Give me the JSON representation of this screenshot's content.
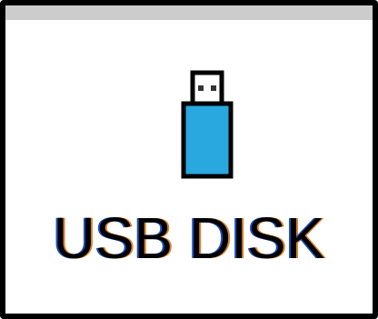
{
  "tile": {
    "label": "USB DISK"
  },
  "icon": {
    "name": "usb-drive-icon",
    "body_color": "#29a8e0",
    "connector_color": "#ffffff",
    "outline_color": "#000000"
  },
  "colors": {
    "header": "#cccccc",
    "border": "#000000",
    "background": "#ffffff"
  }
}
